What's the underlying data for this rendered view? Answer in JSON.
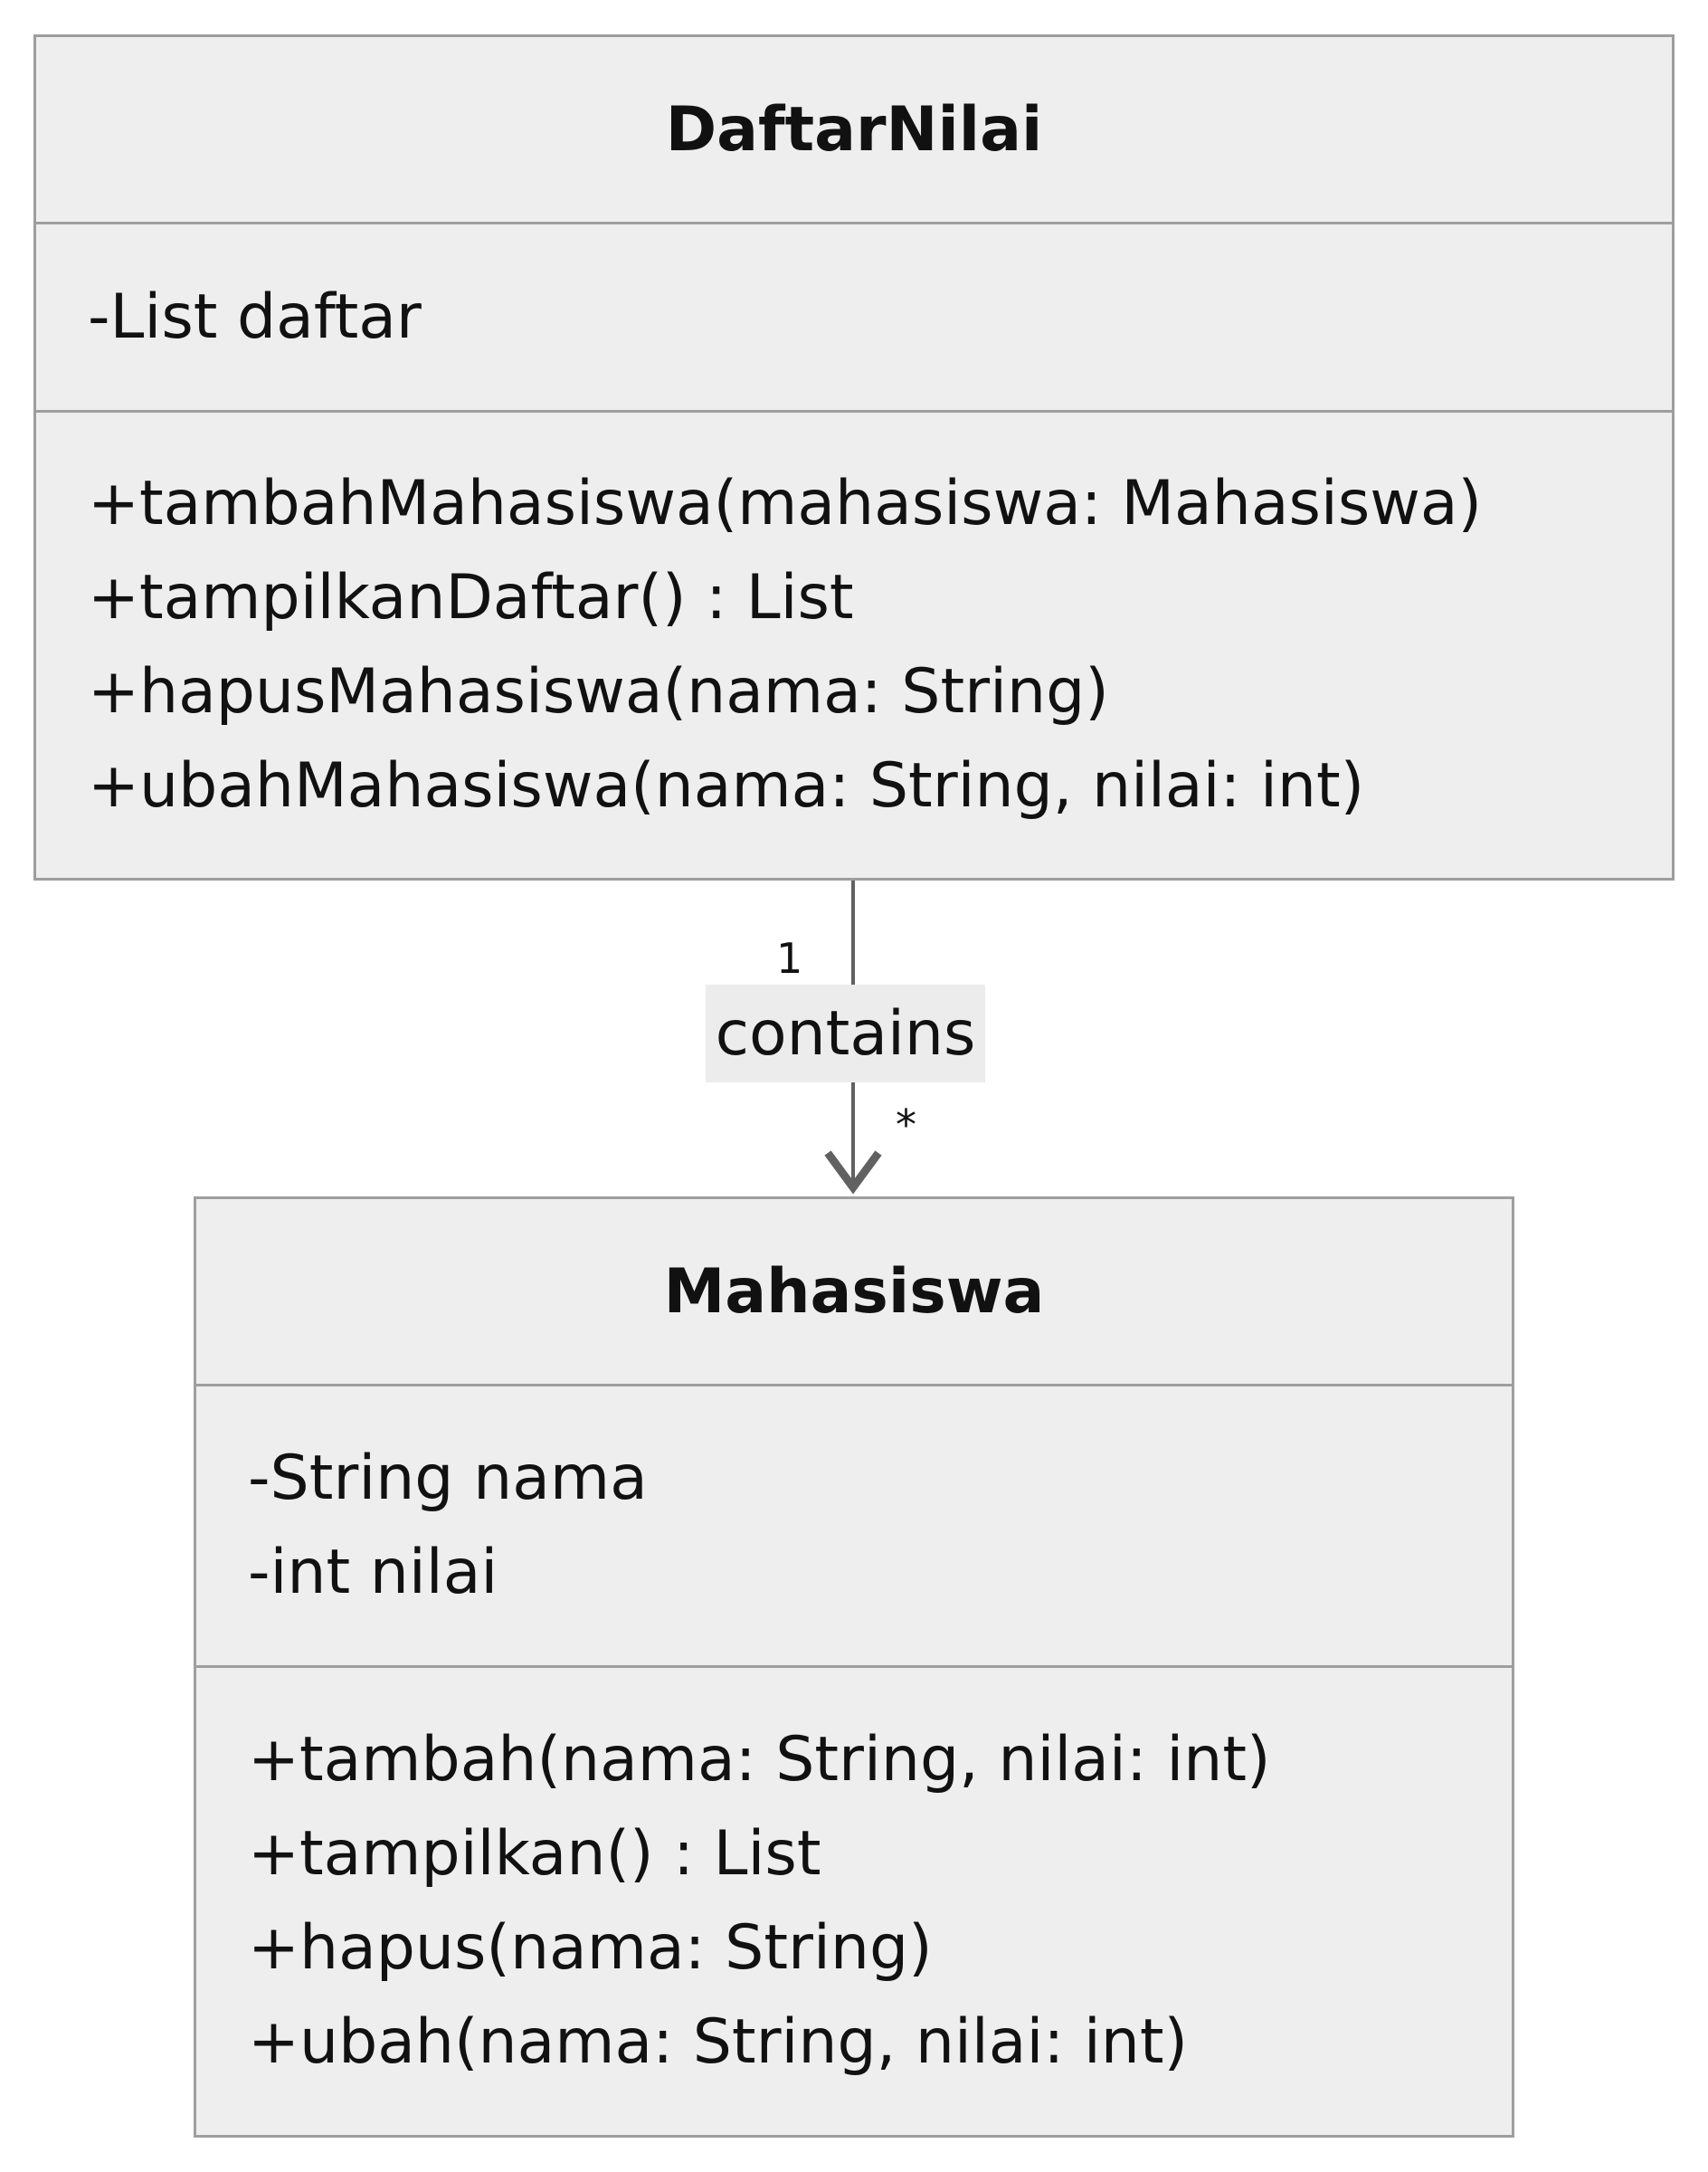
{
  "classes": [
    {
      "name": "DaftarNilai",
      "attributes": [
        "-List daftar"
      ],
      "methods": [
        "+tambahMahasiswa(mahasiswa: Mahasiswa)",
        "+tampilkanDaftar() : List",
        "+hapusMahasiswa(nama: String)",
        "+ubahMahasiswa(nama: String, nilai: int)"
      ]
    },
    {
      "name": "Mahasiswa",
      "attributes": [
        "-String nama",
        "-int nilai"
      ],
      "methods": [
        "+tambah(nama: String, nilai: int)",
        "+tampilkan() : List",
        "+hapus(nama: String)",
        "+ubah(nama: String, nilai: int)"
      ]
    }
  ],
  "relation": {
    "label": "contains",
    "source_multiplicity": "1",
    "target_multiplicity": "*"
  },
  "colors": {
    "class_fill": "#eeeeee",
    "border": "#9e9e9e",
    "arrow": "#616161",
    "text": "#111111"
  }
}
